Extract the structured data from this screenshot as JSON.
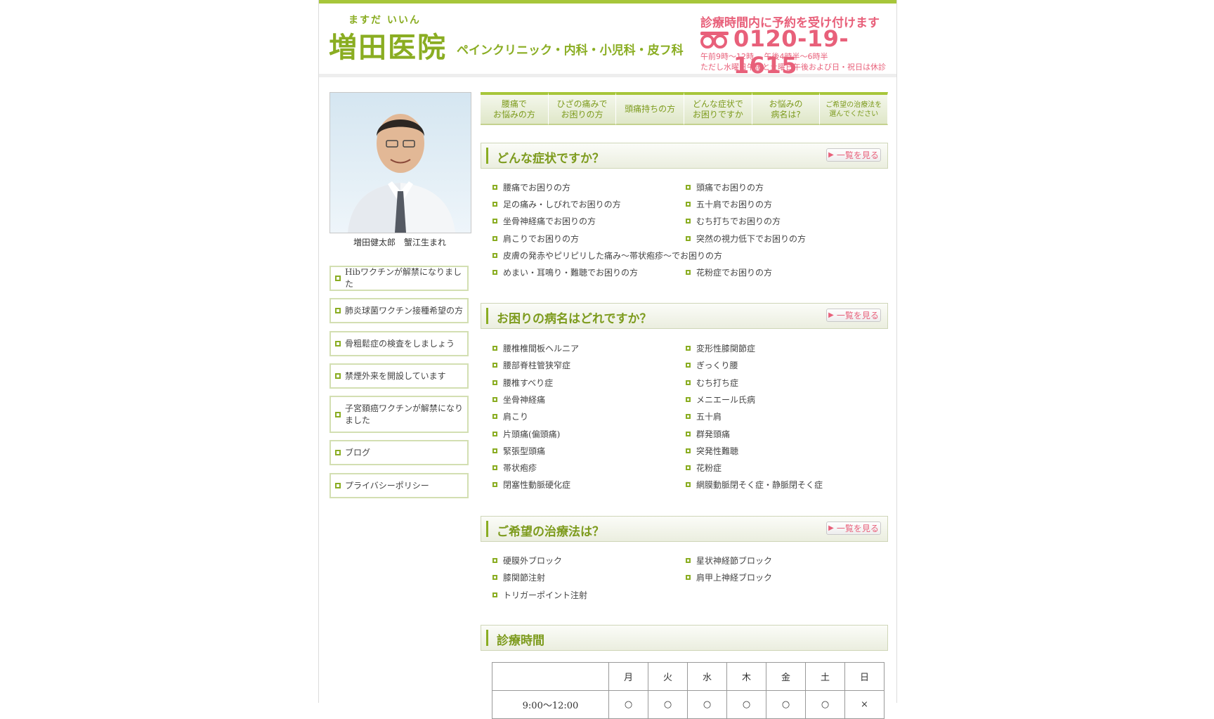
{
  "header": {
    "kana": "ますだ いいん",
    "clinic_name": "増田医院",
    "departments": "ペインクリニック・内科・小児科・皮フ科",
    "reservation_note": "診療時間内に予約を受け付けます",
    "phone": "0120-19-1615",
    "hours_line1": "午前9時～12時　 午後4時半～6時半",
    "hours_line2": "ただし水曜日午後と土曜日午後および日・祝日は休診",
    "freedial_icon": "freedial-icon"
  },
  "doctor": {
    "caption": "増田健太郎　蟹江生まれ"
  },
  "sidebar": {
    "items": [
      {
        "label": "Hibワクチンが解禁になりました"
      },
      {
        "label": "肺炎球菌ワクチン接種希望の方"
      },
      {
        "label": "骨粗鬆症の検査をしましょう"
      },
      {
        "label": "禁煙外来を開設しています"
      },
      {
        "label": "子宮頚癌ワクチンが解禁になりました"
      },
      {
        "label": "ブログ"
      },
      {
        "label": "プライバシーポリシー"
      }
    ]
  },
  "nav": {
    "tabs": [
      {
        "label": "腰痛で\nお悩みの方"
      },
      {
        "label": "ひざの痛みで\nお困りの方"
      },
      {
        "label": "頭痛持ちの方"
      },
      {
        "label": "どんな症状で\nお困りですか"
      },
      {
        "label": "お悩みの\n病名は?"
      },
      {
        "label": "ご希望の治療法を\n選んでください"
      }
    ]
  },
  "more_label": "一覧を見る",
  "symptoms": {
    "title": "どんな症状ですか？",
    "left": [
      "腰痛でお困りの方",
      "足の痛み・しびれでお困りの方",
      "坐骨神経痛でお困りの方",
      "肩こりでお困りの方"
    ],
    "right": [
      "頭痛でお困りの方",
      "五十肩でお困りの方",
      "むち打ちでお困りの方",
      "突然の視力低下でお困りの方"
    ],
    "wide": "皮膚の発赤やピリピリした痛み～帯状疱疹～でお困りの方",
    "last_left": "めまい・耳鳴り・難聴でお困りの方",
    "last_right": "花粉症でお困りの方"
  },
  "diseases": {
    "title": "お困りの病名はどれですか？",
    "left": [
      "腰椎椎間板ヘルニア",
      "腰部脊柱管狭窄症",
      "腰椎すべり症",
      "坐骨神経痛",
      "肩こり",
      "片頭痛(偏頭痛)",
      "緊張型頭痛",
      "帯状疱疹",
      "閉塞性動脈硬化症"
    ],
    "right": [
      "変形性膝関節症",
      "ぎっくり腰",
      "むち打ち症",
      "メニエール氏病",
      "五十肩",
      "群発頭痛",
      "突発性難聴",
      "花粉症",
      "網膜動脈閉そく症・静脈閉そく症"
    ]
  },
  "treatments": {
    "title": "ご希望の治療法は？",
    "left": [
      "硬膜外ブロック",
      "膝関節注射",
      "トリガーポイント注射"
    ],
    "right": [
      "星状神経節ブロック",
      "肩甲上神経ブロック"
    ]
  },
  "schedule": {
    "title": "診療時間",
    "days": [
      "月",
      "火",
      "水",
      "木",
      "金",
      "土",
      "日"
    ],
    "rows": [
      {
        "time": "9:00～12:00",
        "marks": [
          "○",
          "○",
          "○",
          "○",
          "○",
          "○",
          "×"
        ]
      }
    ]
  }
}
